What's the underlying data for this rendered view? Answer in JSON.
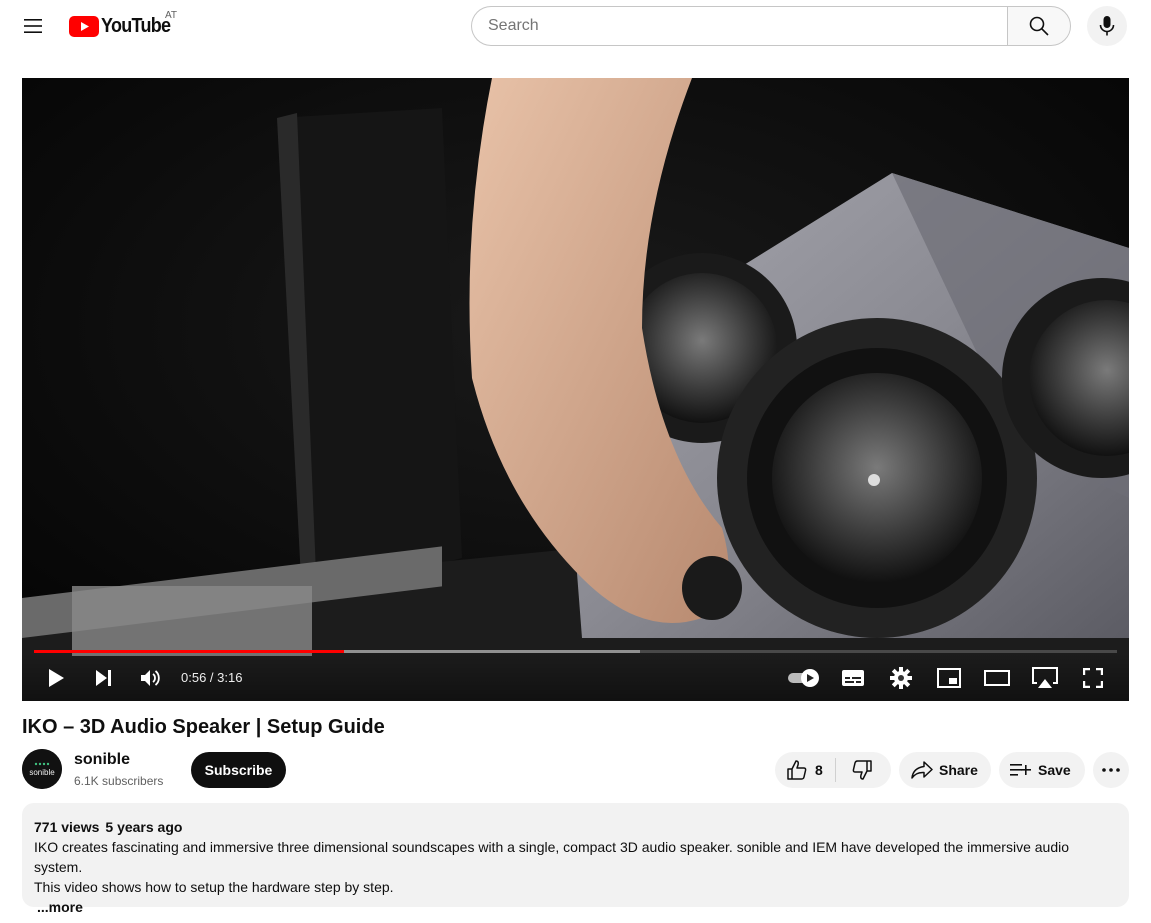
{
  "header": {
    "logo_text": "YouTube",
    "country_code": "AT",
    "search_placeholder": "Search"
  },
  "player": {
    "time_current": "0:56",
    "time_separator": " / ",
    "time_total": "3:16",
    "progress_played_fraction": 0.286,
    "progress_loaded_fraction": 0.56
  },
  "video": {
    "title": "IKO – 3D Audio Speaker | Setup Guide"
  },
  "channel": {
    "name": "sonible",
    "subscribers": "6.1K subscribers",
    "avatar_text": "sonible",
    "subscribe_label": "Subscribe"
  },
  "actions": {
    "like_count": "8",
    "share_label": "Share",
    "save_label": "Save"
  },
  "description": {
    "views": "771 views",
    "age": "5 years ago",
    "line1": "IKO creates fascinating and immersive three dimensional soundscapes with a single, compact 3D audio speaker. sonible and IEM have developed the immersive audio system.",
    "line2": "This video shows how to setup the hardware step by step.",
    "more_label": "...more"
  },
  "colors": {
    "brand_red": "#ff0000",
    "button_dark": "#0f0f0f",
    "pill_bg": "#f2f2f2"
  },
  "icons": [
    "menu-icon",
    "youtube-logo-icon",
    "search-icon",
    "microphone-icon",
    "play-icon",
    "next-icon",
    "volume-icon",
    "autoplay-toggle-icon",
    "subtitles-icon",
    "settings-icon",
    "miniplayer-icon",
    "theater-mode-icon",
    "airplay-icon",
    "fullscreen-icon",
    "thumbs-up-icon",
    "thumbs-down-icon",
    "share-icon",
    "save-playlist-icon",
    "more-icon"
  ]
}
